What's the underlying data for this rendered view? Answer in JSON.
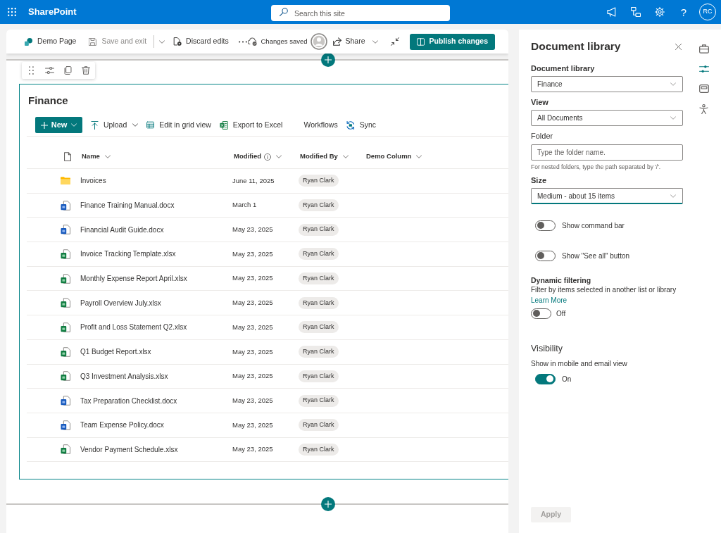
{
  "suite_bar": {
    "app_name": "SharePoint",
    "search": {
      "placeholder": "Search this site"
    },
    "help": "?",
    "avatar": "RC"
  },
  "edit_bar": {
    "page_name": "Demo Page",
    "save": {
      "label": "Save and exit",
      "disabled": true
    },
    "discard": {
      "label": "Discard edits"
    },
    "status": "Changes saved",
    "share": {
      "label": "Share"
    },
    "publish": {
      "label": "Publish changes"
    }
  },
  "web_part": {
    "title": "Finance",
    "commands": [
      {
        "label": "New",
        "primary": true,
        "dropdown": true
      },
      {
        "label": "Upload",
        "primary": false,
        "dropdown": true
      },
      {
        "label": "Edit in grid view",
        "primary": false,
        "dropdown": false
      },
      {
        "label": "Export to Excel",
        "primary": false,
        "dropdown": false
      },
      {
        "label": "Workflows",
        "primary": false,
        "dropdown": false
      },
      {
        "label": "Sync",
        "primary": false,
        "dropdown": false
      }
    ],
    "columns": [
      {
        "label": "Name",
        "info": false
      },
      {
        "label": "Modified",
        "info": true
      },
      {
        "label": "Modified By",
        "info": false
      },
      {
        "label": "Demo Column",
        "info": false
      }
    ],
    "rows": [
      {
        "kind": "folder",
        "name": "Invoices",
        "modified": "June 11, 2025",
        "modified_by": "Ryan Clark"
      },
      {
        "kind": "document",
        "name": "Finance Training Manual.docx",
        "modified": "March 1",
        "modified_by": "Ryan Clark"
      },
      {
        "kind": "document",
        "name": "Financial Audit Guide.docx",
        "modified": "May 23, 2025",
        "modified_by": "Ryan Clark"
      },
      {
        "kind": "spreadsheet",
        "name": "Invoice Tracking Template.xlsx",
        "modified": "May 23, 2025",
        "modified_by": "Ryan Clark"
      },
      {
        "kind": "spreadsheet",
        "name": "Monthly Expense Report April.xlsx",
        "modified": "May 23, 2025",
        "modified_by": "Ryan Clark"
      },
      {
        "kind": "spreadsheet",
        "name": "Payroll Overview July.xlsx",
        "modified": "May 23, 2025",
        "modified_by": "Ryan Clark"
      },
      {
        "kind": "spreadsheet",
        "name": "Profit and Loss Statement Q2.xlsx",
        "modified": "May 23, 2025",
        "modified_by": "Ryan Clark"
      },
      {
        "kind": "spreadsheet",
        "name": "Q1 Budget Report.xlsx",
        "modified": "May 23, 2025",
        "modified_by": "Ryan Clark"
      },
      {
        "kind": "spreadsheet",
        "name": "Q3 Investment Analysis.xlsx",
        "modified": "May 23, 2025",
        "modified_by": "Ryan Clark"
      },
      {
        "kind": "document",
        "name": "Tax Preparation Checklist.docx",
        "modified": "May 23, 2025",
        "modified_by": "Ryan Clark"
      },
      {
        "kind": "document",
        "name": "Team Expense Policy.docx",
        "modified": "May 23, 2025",
        "modified_by": "Ryan Clark"
      },
      {
        "kind": "spreadsheet",
        "name": "Vendor Payment Schedule.xlsx",
        "modified": "May 23, 2025",
        "modified_by": "Ryan Clark"
      }
    ]
  },
  "panel": {
    "title": "Document library",
    "fields": [
      {
        "kind": "dropdown",
        "label": "Document library",
        "value": "Finance",
        "focused": false
      },
      {
        "kind": "dropdown",
        "label": "View",
        "value": "All Documents",
        "focused": false
      },
      {
        "kind": "input",
        "label": "Folder",
        "placeholder": "Type the folder name.",
        "hint": "For nested folders, type the path separated by '/'."
      },
      {
        "kind": "dropdown",
        "label": "Size",
        "value": "Medium - about 15 items",
        "focused": true
      }
    ],
    "toggles": [
      {
        "label": "Show command bar",
        "on": false
      },
      {
        "label": "Show \"See all\" button",
        "on": false
      }
    ],
    "dynamic_filtering": {
      "heading": "Dynamic filtering",
      "description": "Filter by items selected in another list or library",
      "link": "Learn More",
      "toggle": {
        "on": false,
        "state_label": "Off"
      }
    },
    "visibility": {
      "heading": "Visibility",
      "description": "Show in mobile and email view",
      "toggle": {
        "on": true,
        "state_label": "On"
      }
    },
    "apply": {
      "label": "Apply",
      "disabled": true
    }
  },
  "rail": [
    {
      "selected": false
    },
    {
      "selected": true
    },
    {
      "selected": false
    },
    {
      "selected": false
    }
  ]
}
